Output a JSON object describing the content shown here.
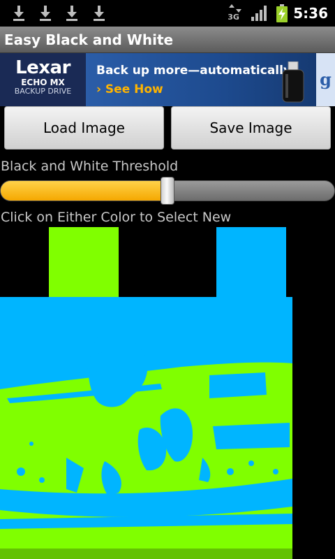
{
  "status_bar": {
    "icons": [
      "download-icon",
      "download-icon",
      "download-icon",
      "download-icon",
      "network-3g-icon",
      "signal-icon",
      "battery-charging-icon"
    ],
    "network": "3G",
    "time": "5:36"
  },
  "app": {
    "title": "Easy Black and White"
  },
  "ad": {
    "brand": "Lexar",
    "product_line1": "ECHO MX",
    "product_line2": "BACKUP DRIVE",
    "headline": "Back up more—automatically",
    "cta": "› See How",
    "network_logo": "g"
  },
  "buttons": {
    "load": "Load Image",
    "save": "Save Image"
  },
  "threshold": {
    "label": "Black and White Threshold",
    "value_fraction": 0.5
  },
  "colors": {
    "instruction": "Click on Either Color to Select New",
    "color_one": "#80ff00",
    "color_two": "#00b5ff"
  }
}
